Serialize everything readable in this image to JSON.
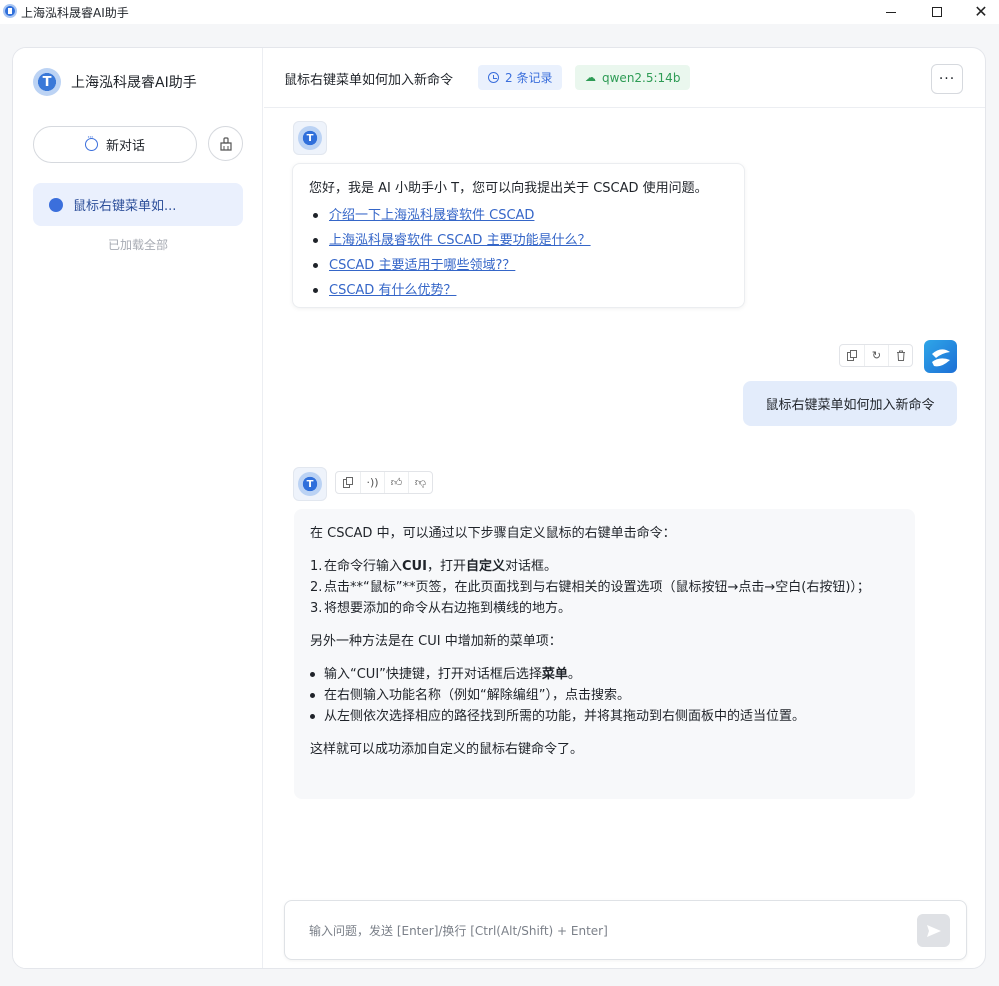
{
  "window": {
    "title": "上海泓科晟睿AI助手",
    "minimize_icon": "minimize-icon",
    "maximize_icon": "maximize-icon",
    "close_icon": "close-icon"
  },
  "sidebar": {
    "brand_name": "上海泓科晟睿AI助手",
    "new_chat_label": "新对话",
    "conversations": [
      {
        "label": "鼠标右键菜单如..."
      }
    ],
    "loaded_all_text": "已加载全部"
  },
  "header": {
    "title": "鼠标右键菜单如何加入新命令",
    "records_badge": "2 条记录",
    "model_badge": "qwen2.5:14b",
    "more_label": "···"
  },
  "messages": {
    "welcome": {
      "text": "您好，我是 AI 小助手小 T，您可以向我提出关于 CSCAD 使用问题。",
      "suggestions": [
        "介绍一下上海泓科晟睿软件 CSCAD",
        "上海泓科晟睿软件 CSCAD 主要功能是什么？",
        "CSCAD 主要适用于哪些领域?？",
        "CSCAD 有什么优势？"
      ]
    },
    "user_question": "鼠标右键菜单如何加入新命令",
    "answer": {
      "intro": "在 CSCAD 中，可以通过以下步骤自定义鼠标的右键单击命令：",
      "steps": [
        {
          "num": "1.",
          "pre": "在命令行输入",
          "bold1": "CUI",
          "mid": "，打开",
          "bold2": "自定义",
          "post": "对话框。"
        },
        {
          "num": "2.",
          "text": "点击**“鼠标”**页签，在此页面找到与右键相关的设置选项（鼠标按钮→点击→空白(右按钮)）；"
        },
        {
          "num": "3.",
          "text": "将想要添加的命令从右边拖到横线的地方。"
        }
      ],
      "alt_intro": "另外一种方法是在 CUI 中增加新的菜单项：",
      "bullets": [
        {
          "pre": "输入“CUI”快捷键，打开对话框后选择",
          "bold": "菜单",
          "post": "。"
        },
        {
          "text": "在右侧输入功能名称（例如“解除编组”），点击搜索。"
        },
        {
          "text": "从左侧依次选择相应的路径找到所需的功能，并将其拖动到右侧面板中的适当位置。"
        }
      ],
      "outro": "这样就可以成功添加自定义的鼠标右键命令了。"
    }
  },
  "input": {
    "placeholder": "输入问题，发送 [Enter]/换行 [Ctrl(Alt/Shift) + Enter]",
    "value": ""
  },
  "colors": {
    "accent": "#3b6fdc",
    "model_badge": "#2e9c55",
    "user_bubble": "#e3ecfb",
    "link": "#3566c8"
  }
}
